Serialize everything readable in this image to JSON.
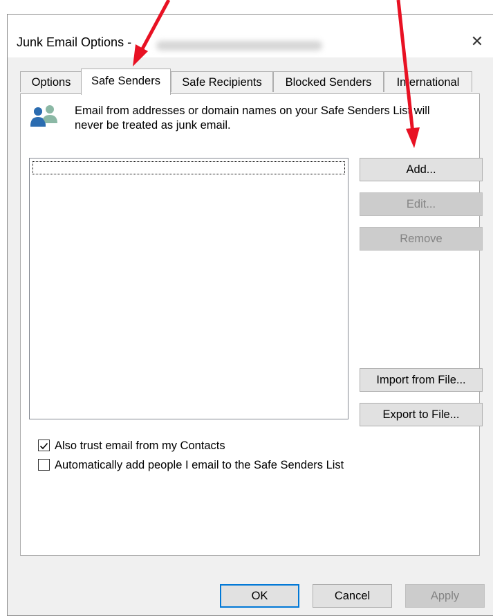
{
  "window": {
    "title": "Junk Email Options -",
    "close_glyph": "✕"
  },
  "tabs": [
    {
      "label": "Options",
      "active": false
    },
    {
      "label": "Safe Senders",
      "active": true
    },
    {
      "label": "Safe Recipients",
      "active": false
    },
    {
      "label": "Blocked Senders",
      "active": false
    },
    {
      "label": "International",
      "active": false
    }
  ],
  "panel": {
    "icon": "people-icon",
    "info_line1": "Email from addresses or domain names on your Safe Senders List will",
    "info_line2": "never be treated as junk email.",
    "list_items": []
  },
  "buttons": {
    "add": {
      "label": "Add...",
      "enabled": true
    },
    "edit": {
      "label": "Edit...",
      "enabled": false
    },
    "remove": {
      "label": "Remove",
      "enabled": false
    },
    "import": {
      "label": "Import from File...",
      "enabled": true
    },
    "export": {
      "label": "Export to File...",
      "enabled": true
    }
  },
  "checkboxes": [
    {
      "label": "Also trust email from my Contacts",
      "checked": true
    },
    {
      "label": "Automatically add people I email to the Safe Senders List",
      "checked": false
    }
  ],
  "footer": {
    "ok": "OK",
    "cancel": "Cancel",
    "apply": "Apply",
    "apply_enabled": false
  },
  "colors": {
    "annotation_arrow": "#e81123",
    "default_button_border": "#0078d7"
  }
}
